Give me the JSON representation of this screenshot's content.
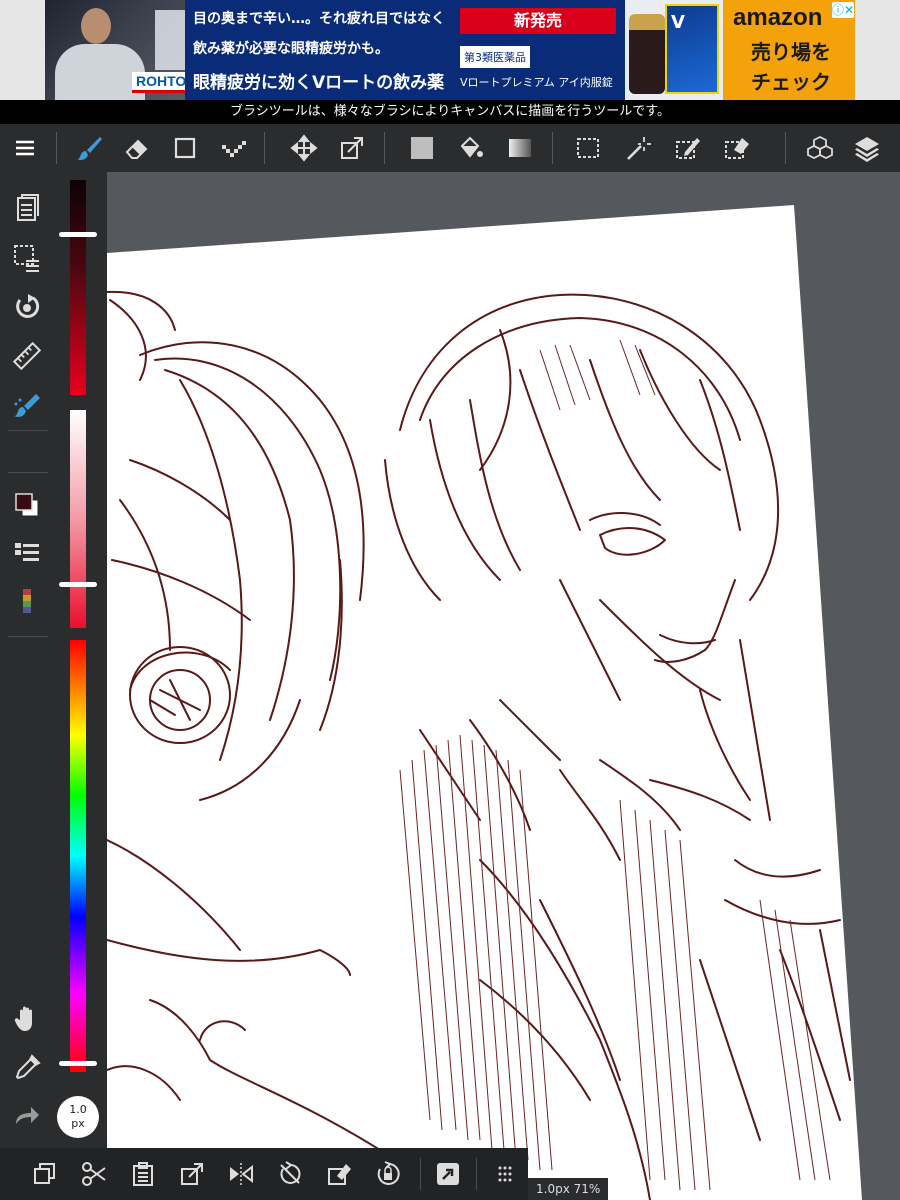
{
  "ad": {
    "headline1": "目の奥まで辛い…。それ疲れ目ではなく",
    "headline2": "飲み薬が必要な眼精疲労かも。",
    "headline3": "眼精疲労に効くVロートの飲み薬",
    "brand": "ROHTO",
    "badge_new": "新発売",
    "category": "第3類医薬品",
    "product": "Vロートプレミアム アイ内服錠",
    "package_text": "V",
    "amazon_logo": "amazon",
    "amazon_line1": "売り場を",
    "amazon_line2": "チェック",
    "adchoices": "ⓘ",
    "close": "✕"
  },
  "info_message": "ブラシツールは、様々なブラシによりキャンバスに描画を行うツールです。",
  "toolbar": {
    "menu": "menu-icon",
    "active_tool": "brush",
    "tools": [
      "brush",
      "eraser",
      "shape",
      "dot",
      "move",
      "transform",
      "fill-color",
      "bucket",
      "gradient",
      "select",
      "magic-wand",
      "select-pen",
      "select-eraser",
      "3d-material",
      "layers"
    ]
  },
  "sidebar": {
    "items": [
      "pages",
      "selection",
      "rotate",
      "ruler",
      "brush-control",
      "color",
      "brush-list",
      "color-palette",
      "hand",
      "eyedropper",
      "redo"
    ]
  },
  "colors": {
    "primary": "#3a0a12",
    "secondary": "#ffffff",
    "stroke": "#5a1818",
    "accent": "#3d9bd8",
    "slider_dark_level": 0.25,
    "slider_sat_level": 0.8,
    "slider_hue_level": 0.98
  },
  "brush": {
    "size_value": "1.0",
    "size_unit": "px"
  },
  "status": {
    "text": "1.0px 71%"
  },
  "bottom_toolbar": {
    "items": [
      "duplicate",
      "cut",
      "paste",
      "transform",
      "flip",
      "deselect",
      "clear",
      "rotate-lock",
      "share",
      "more"
    ]
  }
}
